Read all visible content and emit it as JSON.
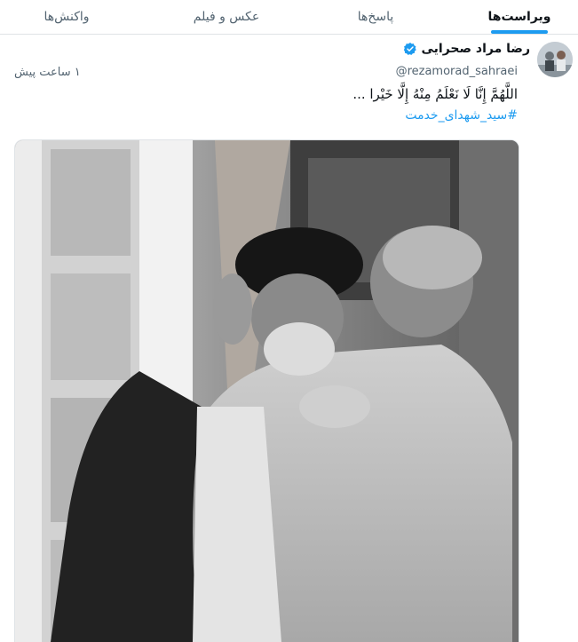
{
  "tabs": [
    {
      "label": "واکنش‌ها",
      "active": false
    },
    {
      "label": "عکس و فیلم",
      "active": false
    },
    {
      "label": "پاسخ‌ها",
      "active": false
    },
    {
      "label": "ویراست‌ها",
      "active": true
    }
  ],
  "tweet": {
    "author_name": "رضا مراد صحرایی",
    "handle": "@rezamorad_sahraei",
    "time": "۱ ساعت پیش",
    "text": "اللَّهُمَّ إِنَّا لَا نَعْلَمُ مِنْهُ إِلَّا خَيْرا ...",
    "hashtag": "#سید_شهدای_خدمت",
    "verified_color": "#1d9bf0",
    "accent_color": "#1d9bf0"
  }
}
